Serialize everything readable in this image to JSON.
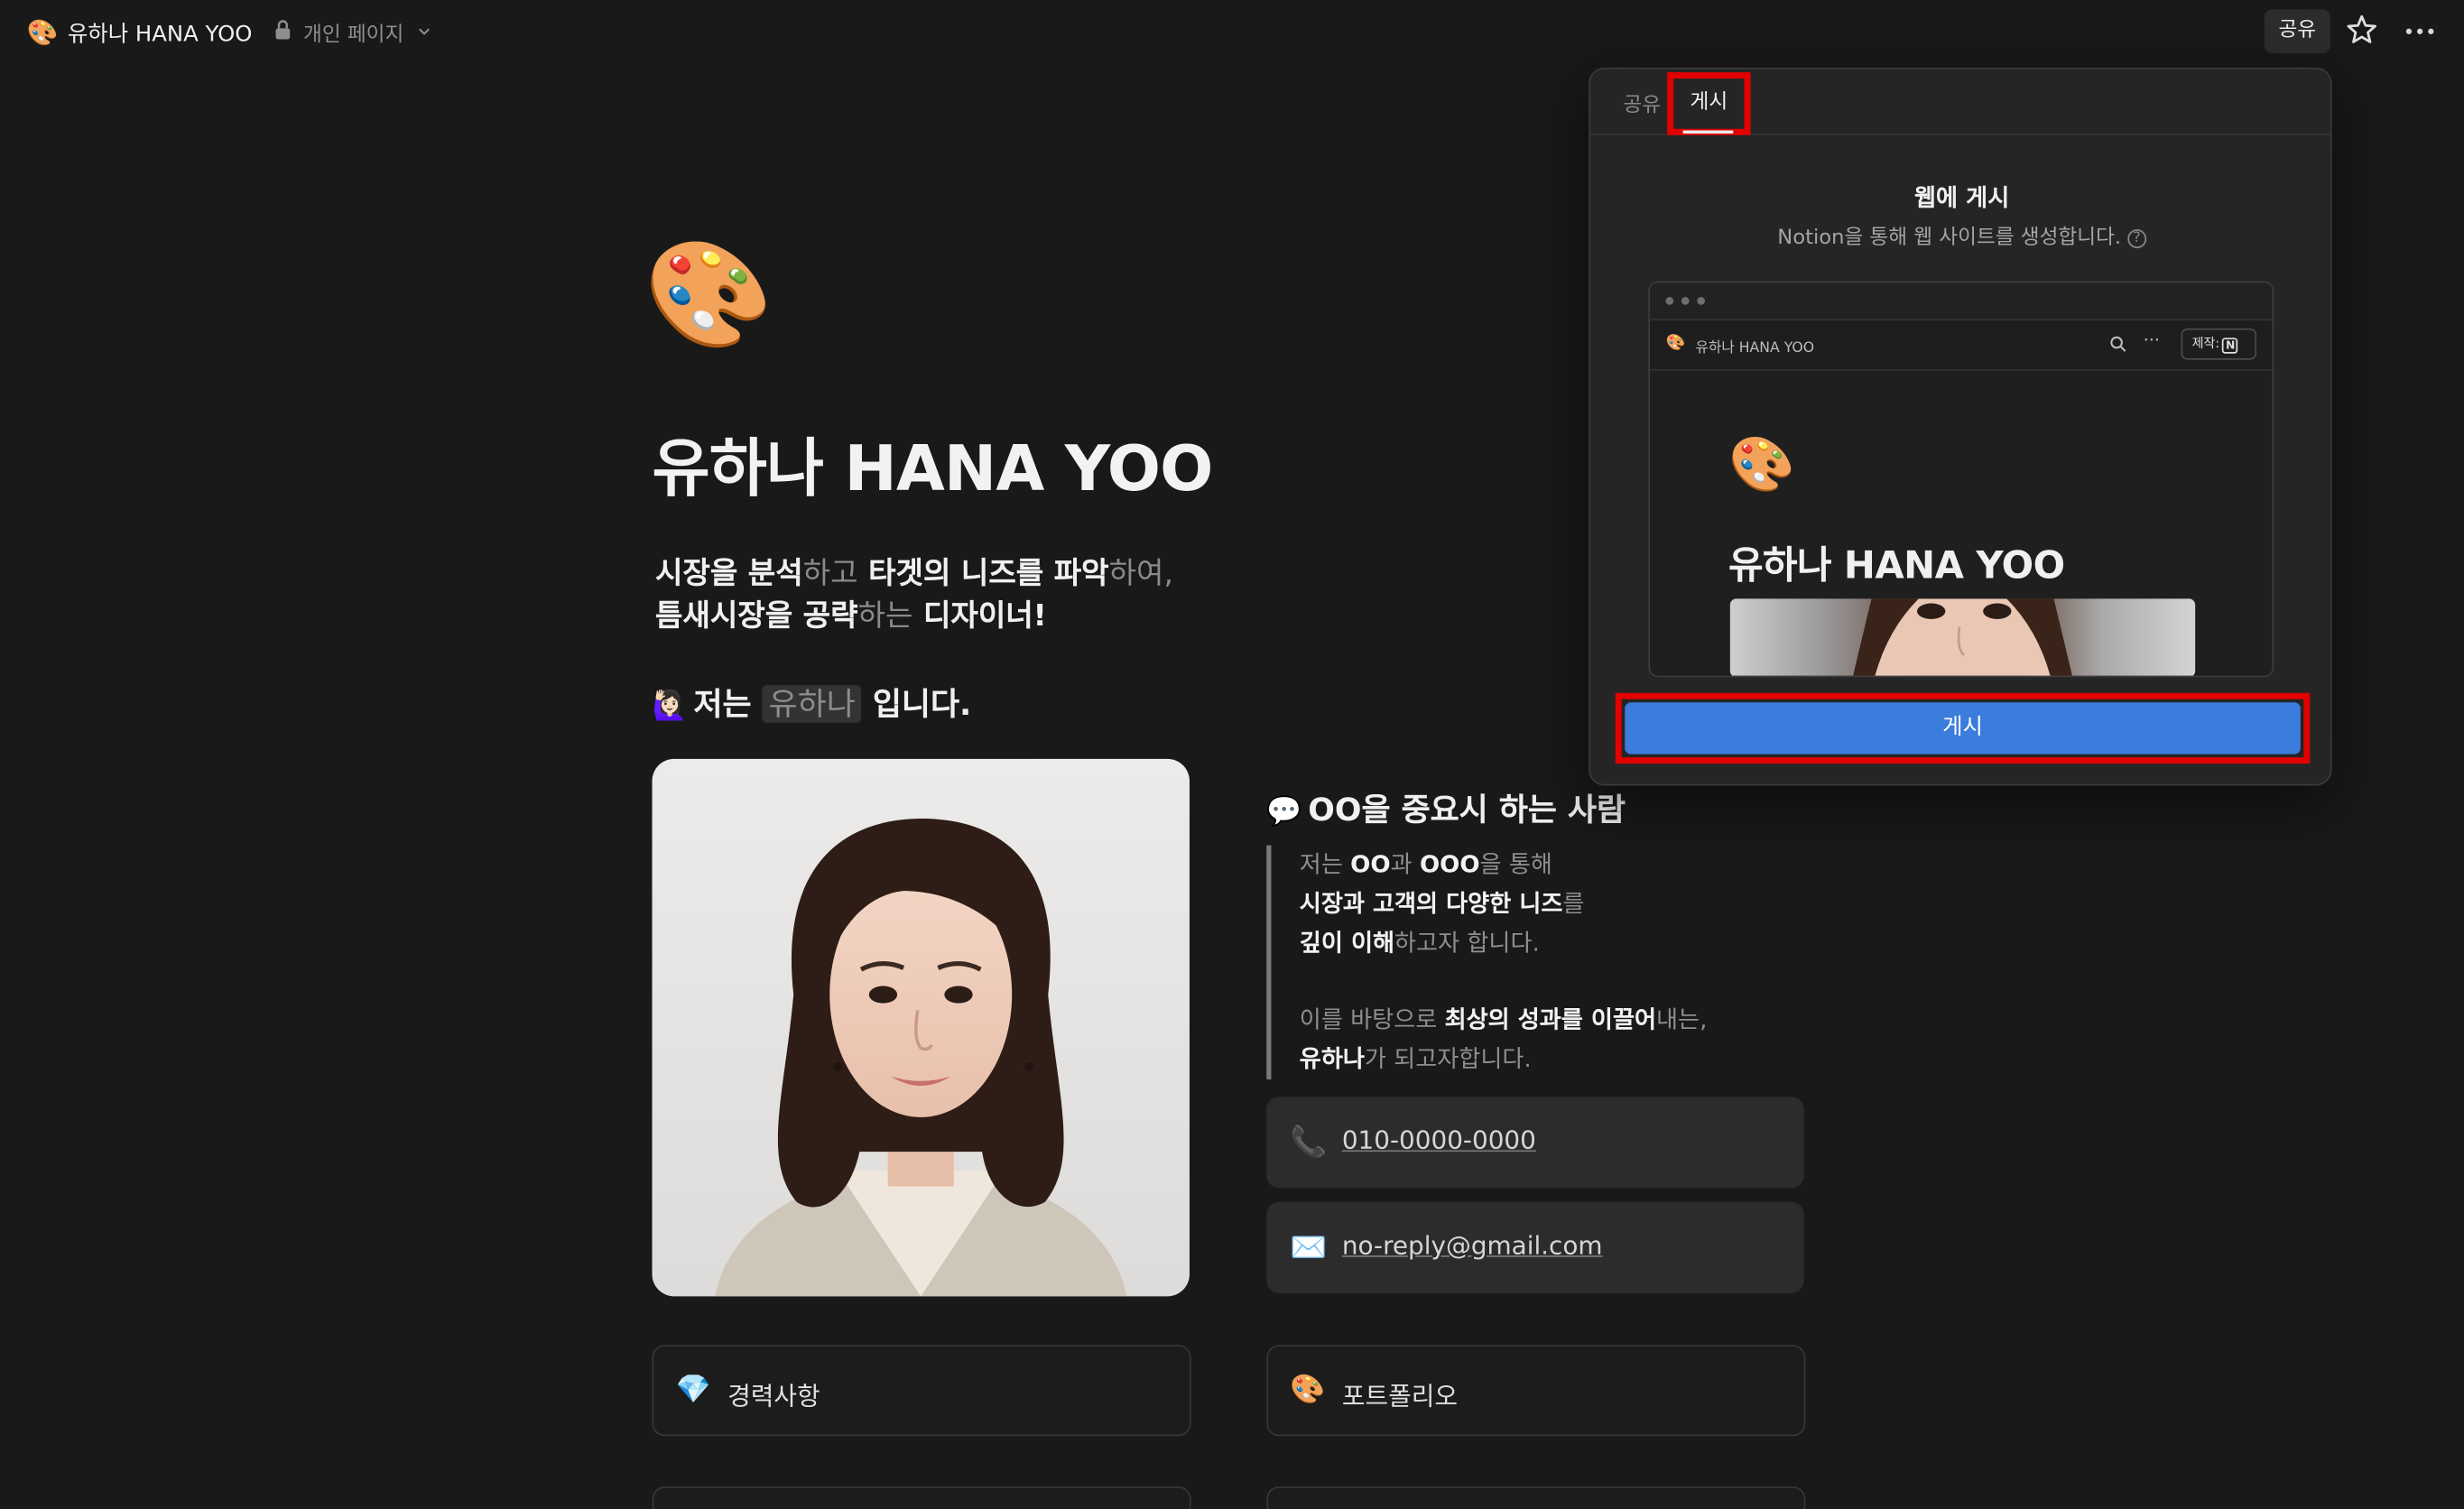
{
  "topbar": {
    "page_emoji": "🎨",
    "page_title": "유하나 HANA YOO",
    "privacy_label": "개인 페이지",
    "share_label": "공유"
  },
  "page": {
    "icon_emoji": "🎨",
    "title": "유하나 HANA YOO",
    "tagline": {
      "l1a": "시장을 분석",
      "l1b": "하고",
      "l1c": " 타겟의 니즈를 파악",
      "l1d": "하여,",
      "l2a": "틈새시장을 공략",
      "l2b": "하는",
      "l2c": " 디자이너!"
    },
    "intro": {
      "emoji": "🙋🏻‍♀️",
      "before": "저는 ",
      "highlight": "유하나",
      "after": " 입니다."
    },
    "quote_heading": {
      "emoji": "💬",
      "text": "OO을 중요시 하는 사람"
    },
    "quote": {
      "p1": "저는 ",
      "p2": "OO",
      "p3": "과 ",
      "p4": "OOO",
      "p5": "을 통해",
      "p6": "시장과 고객의 다양한 니즈",
      "p7": "를",
      "p8": "깊이 이해",
      "p9": "하고자 합니다.",
      "p10": "이를 바탕으로 ",
      "p11": "최상의 성과를 이끌어",
      "p12": "내는,",
      "p13": "유하나",
      "p14": "가 되고자합니다."
    },
    "phone": "010-0000-0000",
    "email": "no-reply@gmail.com",
    "cards": {
      "career": {
        "emoji": "💎",
        "label": "경력사항"
      },
      "portfolio": {
        "emoji": "🎨",
        "label": "포트폴리오"
      }
    }
  },
  "popover": {
    "tab_share": "공유",
    "tab_publish": "게시",
    "heading": "웹에 게시",
    "subtitle": "Notion을 통해 웹 사이트를 생성합니다.",
    "preview": {
      "emoji": "🎨",
      "bar_title": "유하나 HANA YOO",
      "made_with": "제작:",
      "notion_glyph": "N",
      "title": "유하나 HANA YOO"
    },
    "publish_button": "게시"
  }
}
